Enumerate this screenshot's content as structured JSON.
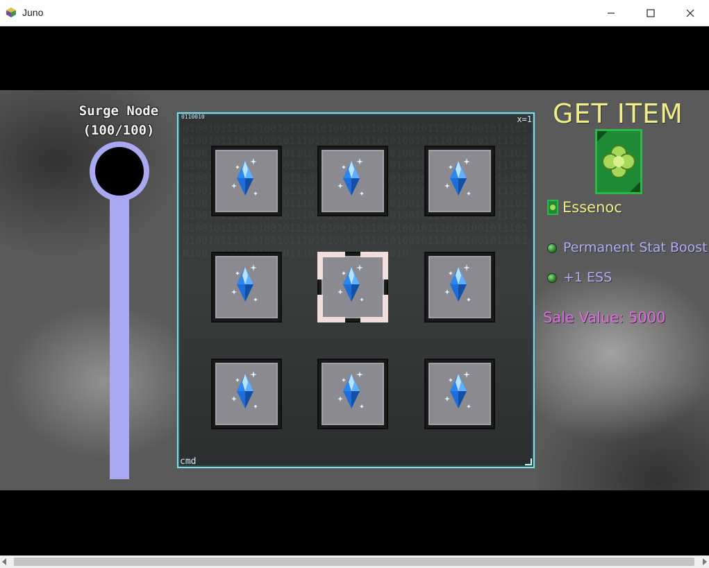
{
  "window": {
    "title": "Juno",
    "icon": "juno-app-icon"
  },
  "surge_node": {
    "title": "Surge Node",
    "count": "(100/100)"
  },
  "panel": {
    "tag_top_left": "0110010",
    "tag_top_right": "x=1",
    "tag_bottom_left": "cmd",
    "background_text": "0100101110101001011101010010111010100101110101001011101010010111010100101110101001011101010010111010100101110101001011101010010111010100101110101001011101010010111010100101110101001011101010010111010100101110101001011101010010111010100101110101001011101010010111010100101110101001011101010010111010100101110101001011101010010111010100101110101001011101010010111010100101110101001011101010010111010100101110101001011101010010111010100101110101001011101010010111010100101110101001011101010010111010100101110101001011101010010111010100101110101001011101010010111010100101110101001011101010"
  },
  "grid": {
    "slots": [
      {
        "item": "blue-crystal-icon",
        "selected": false
      },
      {
        "item": "blue-crystal-icon",
        "selected": false
      },
      {
        "item": "blue-crystal-icon",
        "selected": false
      },
      {
        "item": "blue-crystal-icon",
        "selected": false
      },
      {
        "item": "blue-crystal-icon",
        "selected": true
      },
      {
        "item": "blue-crystal-icon",
        "selected": false
      },
      {
        "item": "blue-crystal-icon",
        "selected": false
      },
      {
        "item": "blue-crystal-icon",
        "selected": false
      },
      {
        "item": "blue-crystal-icon",
        "selected": false
      }
    ]
  },
  "reward": {
    "heading": "GET ITEM",
    "item_name": "Essenoc",
    "effects": [
      "Permanent Stat Boost",
      "+1 ESS"
    ],
    "sale_value": "Sale Value: 5000"
  },
  "colors": {
    "node_bar": "#a9a9f2",
    "heading": "#f1ee8a",
    "effect_text": "#b0aef5",
    "sale_text": "#e06ae0",
    "panel_border": "#8fd8e4"
  }
}
